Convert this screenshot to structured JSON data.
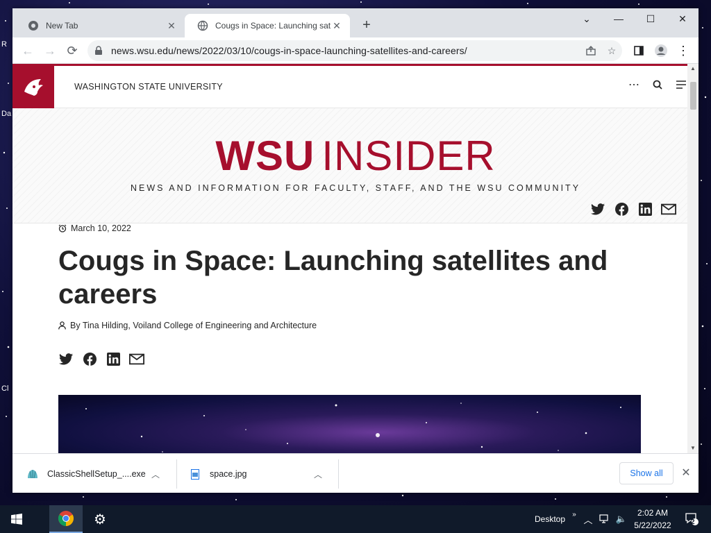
{
  "desktop": {
    "labels": [
      "R",
      "Da",
      "Cl"
    ]
  },
  "browser": {
    "tabs": [
      {
        "title": "New Tab",
        "active": false
      },
      {
        "title": "Cougs in Space: Launching satellites and careers",
        "active": true
      }
    ],
    "url": "news.wsu.edu/news/2022/03/10/cougs-in-space-launching-satellites-and-careers/"
  },
  "site": {
    "university_name": "WASHINGTON STATE UNIVERSITY",
    "masthead": {
      "title_bold": "WSU",
      "title_light": "INSIDER",
      "tagline": "NEWS AND INFORMATION FOR FACULTY, STAFF, AND THE WSU COMMUNITY"
    },
    "brand_color": "#a60f2d"
  },
  "article": {
    "date": "March 10, 2022",
    "headline": "Cougs in Space: Launching satellites and careers",
    "byline": "By Tina Hilding, Voiland College of Engineering and Architecture"
  },
  "downloads": {
    "items": [
      {
        "name": "ClassicShellSetup_....exe"
      },
      {
        "name": "space.jpg"
      }
    ],
    "show_all": "Show all"
  },
  "taskbar": {
    "desktop_label": "Desktop",
    "time": "2:02 AM",
    "date": "5/22/2022",
    "notification_count": "2"
  }
}
